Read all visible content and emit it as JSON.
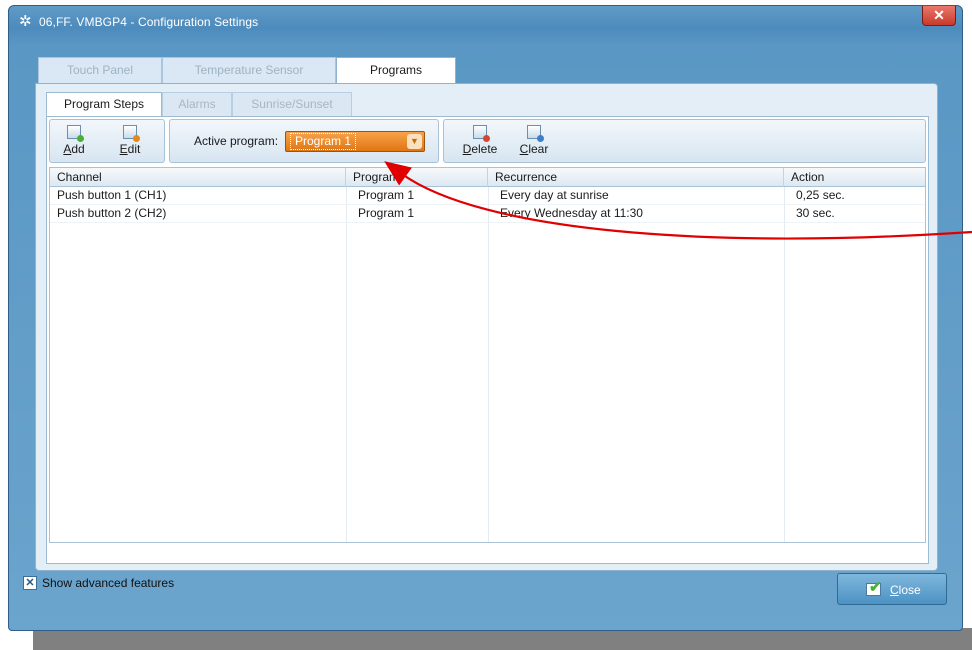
{
  "window": {
    "title": "06,FF. VMBGP4 - Configuration Settings",
    "close_glyph": "✕"
  },
  "tabs": [
    {
      "label": "Touch Panel",
      "active": false
    },
    {
      "label": "Temperature Sensor",
      "active": false
    },
    {
      "label": "Programs",
      "active": true
    }
  ],
  "subtabs": [
    {
      "label": "Program Steps",
      "active": true
    },
    {
      "label": "Alarms",
      "active": false
    },
    {
      "label": "Sunrise/Sunset",
      "active": false
    }
  ],
  "toolbar": {
    "add_label_u": "A",
    "add_label_rest": "dd",
    "edit_label_u": "E",
    "edit_label_rest": "dit",
    "delete_label_u": "D",
    "delete_label_rest": "elete",
    "clear_label_u": "C",
    "clear_label_rest": "lear",
    "active_program_label": "Active program:",
    "active_program_value": "Program 1"
  },
  "grid": {
    "columns": [
      "Channel",
      "Program",
      "Recurrence",
      "Action"
    ],
    "rows": [
      [
        "Push button 1 (CH1)",
        "Program 1",
        "Every day at sunrise",
        "0,25 sec."
      ],
      [
        "Push button 2 (CH2)",
        "Program 1",
        "Every Wednesday at 11:30",
        "30 sec."
      ]
    ]
  },
  "footer": {
    "show_advanced_label": "Show advanced features",
    "show_advanced_checked": true,
    "close_label_u": "C",
    "close_label_rest": "lose"
  },
  "colors": {
    "title_bar": "#4d8bbd",
    "accent_orange": "#e07610",
    "annotation_arrow": "#e00000"
  },
  "icons": {
    "title": "gear-icon",
    "add": "add-step-icon",
    "edit": "edit-step-icon",
    "delete": "delete-step-icon",
    "clear": "clear-steps-icon",
    "close": "checkmark-icon"
  }
}
